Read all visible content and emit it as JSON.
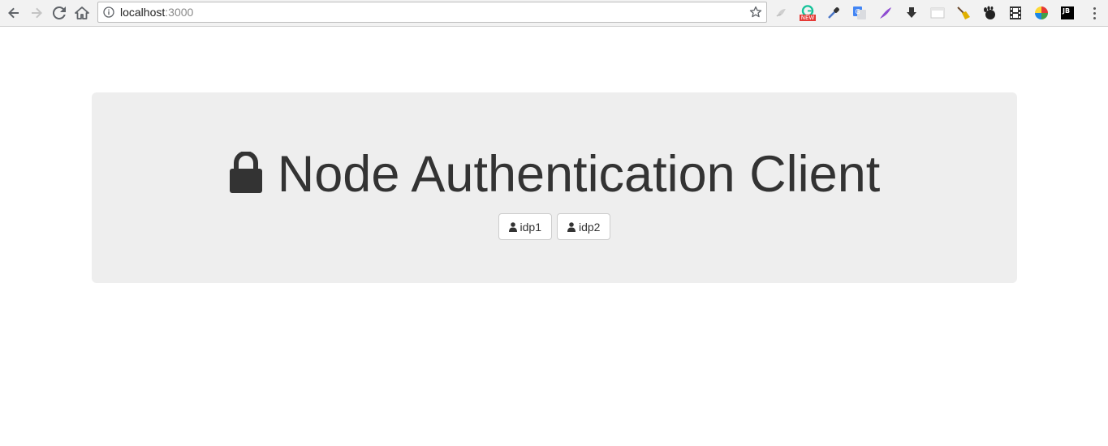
{
  "browser": {
    "url_host": "localhost",
    "url_port": ":3000",
    "nav_icons": [
      "back-icon",
      "forward-icon",
      "reload-icon",
      "home-icon"
    ],
    "extensions": [
      {
        "name": "chrome-ext-gray-icon",
        "color": "#bdbdbd"
      },
      {
        "name": "grammarly-icon",
        "color": "#15c39a",
        "badge": "NEW"
      },
      {
        "name": "eyedropper-icon",
        "color": "#4a76c7"
      },
      {
        "name": "google-translate-icon",
        "color": "#4285f4"
      },
      {
        "name": "feather-icon",
        "color": "#8e4bd1"
      },
      {
        "name": "download-icon",
        "color": "#333333"
      },
      {
        "name": "window-icon",
        "color": "#bdbdbd"
      },
      {
        "name": "broom-icon",
        "color": "#e0b000"
      },
      {
        "name": "gnome-icon",
        "color": "#222222"
      },
      {
        "name": "film-icon",
        "color": "#333333"
      },
      {
        "name": "color-wheel-icon",
        "color": "#e53935"
      },
      {
        "name": "jetbrains-icon",
        "color": "#000000",
        "label": "JB"
      }
    ]
  },
  "page": {
    "title": "Node Authentication Client",
    "buttons": [
      {
        "label": "idp1"
      },
      {
        "label": "idp2"
      }
    ],
    "colors": {
      "jumbotron_bg": "#eeeeee",
      "text": "#333333"
    }
  }
}
